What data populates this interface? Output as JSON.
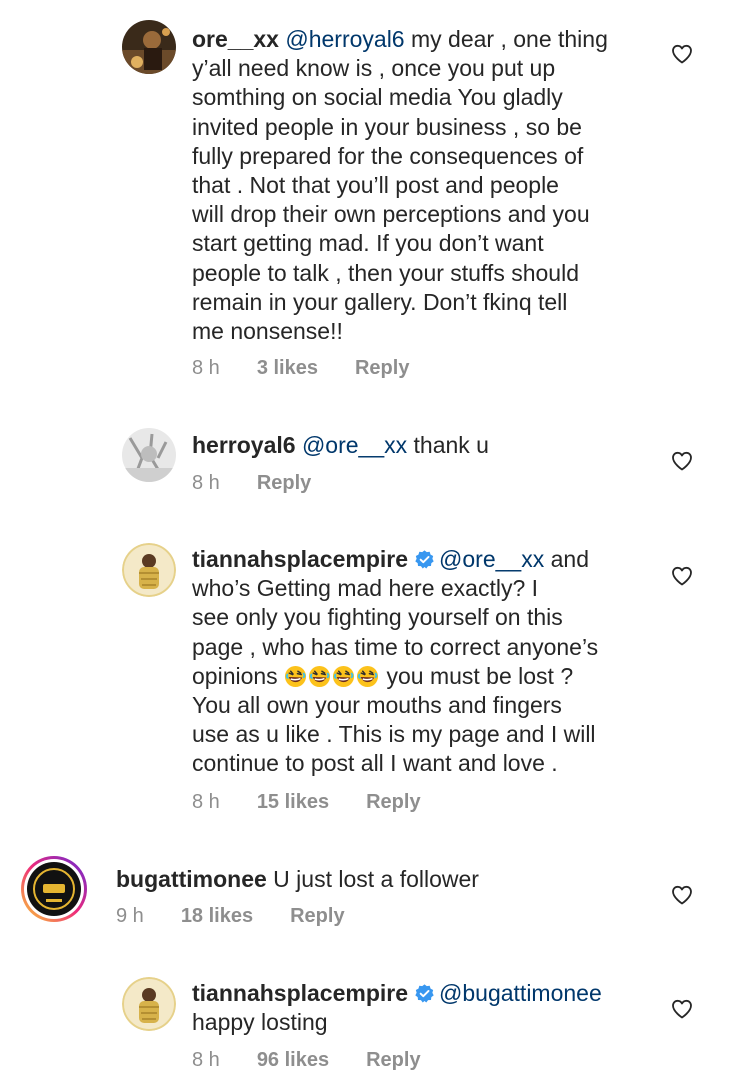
{
  "comments": [
    {
      "username": "ore__xx",
      "mention": "@herroyal6",
      "text_lines": [
        " my dear ,  one thing",
        "y’all need know is , once you put up",
        "somthing on social media  You gladly",
        "invited people in your business , so be",
        "fully prepared for the consequences of",
        "that .  Not that you’ll post and people",
        "will drop their own perceptions and you",
        "start getting mad.  If you don’t want",
        "people to talk , then your stuffs should",
        "remain in your gallery.  Don’t fkinq tell",
        "me nonsense!!"
      ],
      "time": "8 h",
      "likes": "3 likes",
      "reply": "Reply"
    },
    {
      "username": "herroyal6",
      "mention": "@ore__xx",
      "text": " thank u",
      "time": "8 h",
      "reply": "Reply"
    },
    {
      "username": "tiannahsplacempire",
      "mention": "@ore__xx",
      "first_line_rest": " and",
      "text_lines": [
        "who’s Getting mad here exactly? I",
        "see only you fighting yourself on this",
        "page , who has time to correct anyone’s"
      ],
      "opinions_prefix": "opinions ",
      "emoji_name": "rolling-on-floor-laughing-emoji",
      "opinions_suffix": " you must be lost ?",
      "text_lines_2": [
        "You all own your mouths and fingers",
        "use as u like . This is my page and I will",
        "continue to post all I want and love ."
      ],
      "time": "8 h",
      "likes": "15 likes",
      "reply": "Reply"
    },
    {
      "username": "bugattimonee",
      "text": " U just lost a follower",
      "time": "9 h",
      "likes": "18 likes",
      "reply": "Reply"
    },
    {
      "username": "tiannahsplacempire",
      "mention": "@bugattimonee",
      "text_lines": [
        "happy losting"
      ],
      "time": "8 h",
      "likes": "96 likes",
      "reply": "Reply"
    }
  ],
  "icons": {
    "like": "heart-outline-icon",
    "verified": "verified-badge-icon"
  },
  "colors": {
    "text": "#262626",
    "mention": "#00376b",
    "meta": "#8e8e8e",
    "verified": "#3897f0",
    "story_ring_start": "#f9ce34",
    "story_ring_end": "#c13584"
  }
}
